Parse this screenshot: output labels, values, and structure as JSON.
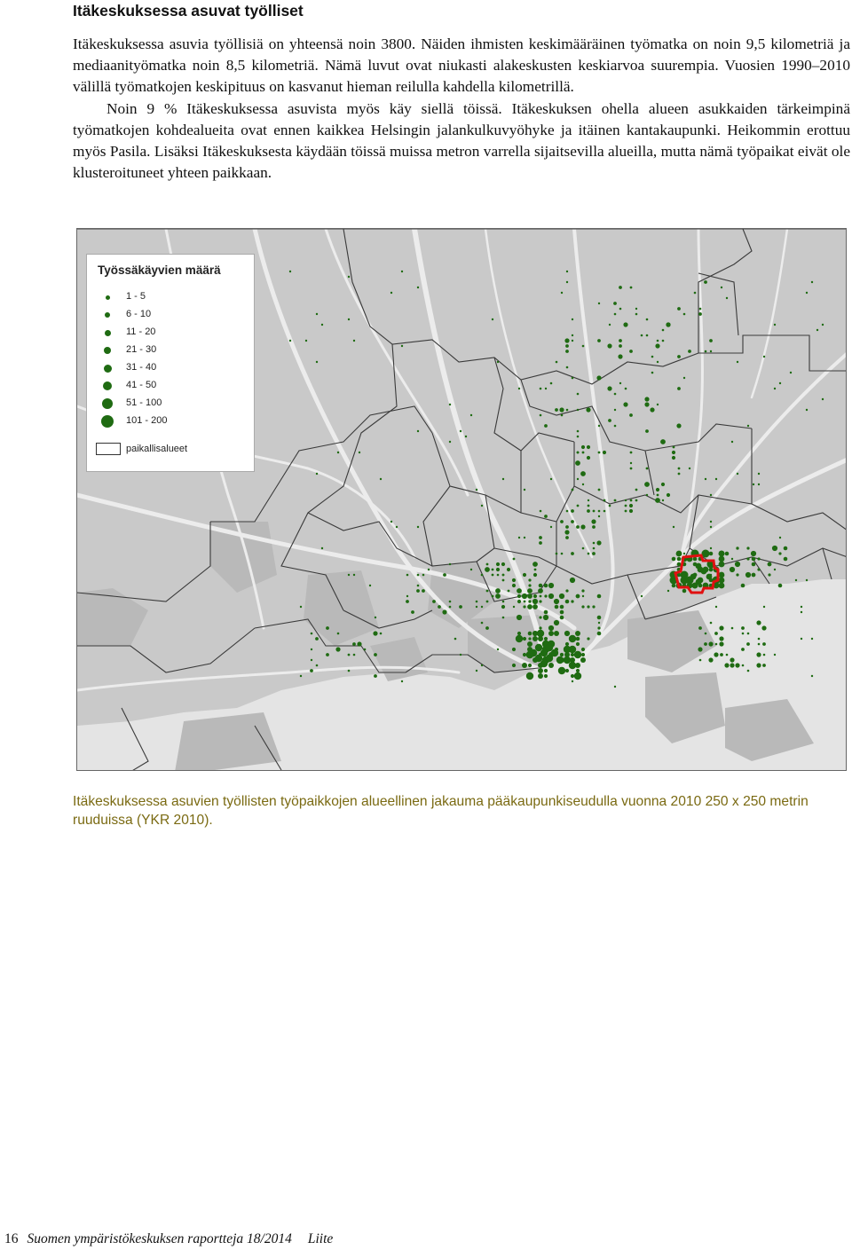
{
  "section_heading": "Itäkeskuksessa asuvat työlliset",
  "paragraphs": [
    "Itäkeskuksessa asuvia työllisiä on yhteensä noin 3800. Näiden ihmisten keskimääräinen työmatka on noin 9,5 kilometriä ja mediaanityömatka noin 8,5 kilometriä. Nämä luvut ovat niukasti alakeskusten keskiarvoa suurempia. Vuosien 1990–2010 välillä työmatkojen keskipituus on kasvanut hieman reilulla kahdella kilometrillä.",
    "Noin 9 % Itäkeskuksessa asuvista myös käy siellä töissä. Itäkeskuksen ohella alueen asukkaiden tärkeimpinä työmatkojen kohdealueita ovat ennen kaikkea Helsingin jalankulkuvyöhyke ja itäinen kantakaupunki. Heikommin erottuu myös Pasila. Lisäksi Itäkeskuksesta käydään töissä muissa metron varrella sijaitsevilla alueilla, mutta nämä työpaikat eivät ole klusteroituneet yhteen paikkaan."
  ],
  "map": {
    "legend": {
      "title": "Työssäkäyvien määrä",
      "classes": [
        "1 - 5",
        "6 - 10",
        "11 - 20",
        "21 - 30",
        "31 - 40",
        "41 - 50",
        "51 - 100",
        "101 - 200"
      ],
      "area_label": "paikallisalueet"
    },
    "colors": {
      "dot": "#1f6b12",
      "land": "#c9c9c9",
      "sea": "#e6e6e6",
      "roads": "#ececec",
      "boundary": "#3a3a3a",
      "highlight": "#e01010"
    },
    "icons": [
      "legend-dot-icon",
      "area-swatch-icon"
    ]
  },
  "caption": "Itäkeskuksessa asuvien työllisten työpaikkojen alueellinen jakauma pääkaupunkiseudulla vuonna 2010 250 x 250 metrin ruuduissa (YKR 2010).",
  "footer": {
    "page_number": "16",
    "series": "Suomen ympäristökeskuksen raportteja 18/2014",
    "suffix": "Liite"
  }
}
